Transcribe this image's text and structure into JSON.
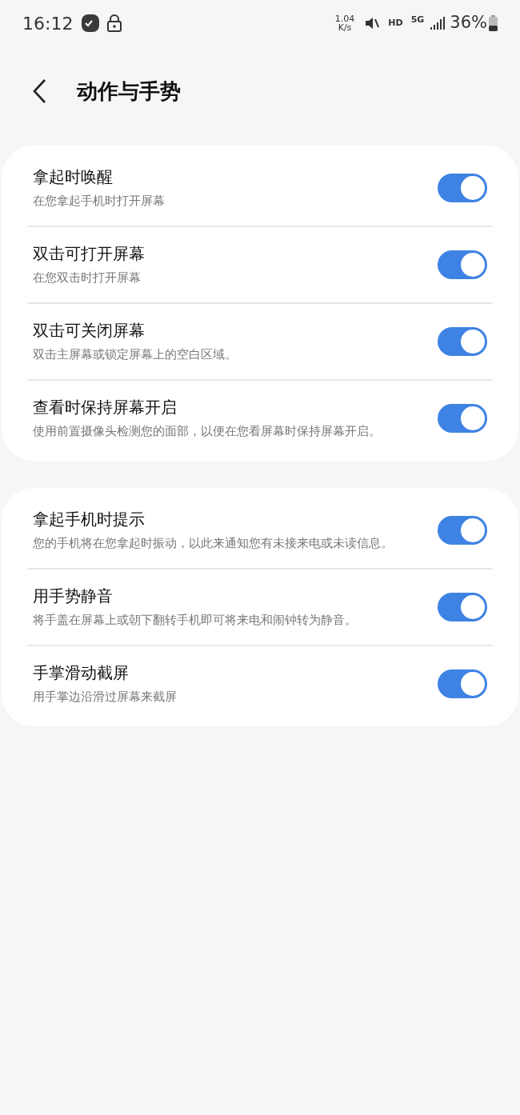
{
  "status_bar": {
    "time": "16:12",
    "net_speed": "1.04",
    "net_unit": "K/s",
    "hd": "HD",
    "network": "5G",
    "battery": "36%"
  },
  "header": {
    "title": "动作与手势"
  },
  "groups": [
    {
      "items": [
        {
          "title": "拿起时唤醒",
          "subtitle": "在您拿起手机时打开屏幕",
          "on": true
        },
        {
          "title": "双击可打开屏幕",
          "subtitle": "在您双击时打开屏幕",
          "on": true
        },
        {
          "title": "双击可关闭屏幕",
          "subtitle": "双击主屏幕或锁定屏幕上的空白区域。",
          "on": true
        },
        {
          "title": "查看时保持屏幕开启",
          "subtitle": "使用前置摄像头检测您的面部，以便在您看屏幕时保持屏幕开启。",
          "on": true
        }
      ]
    },
    {
      "items": [
        {
          "title": "拿起手机时提示",
          "subtitle": "您的手机将在您拿起时振动，以此来通知您有未接来电或未读信息。",
          "on": true
        },
        {
          "title": "用手势静音",
          "subtitle": "将手盖在屏幕上或朝下翻转手机即可将来电和闹钟转为静音。",
          "on": true
        },
        {
          "title": "手掌滑动截屏",
          "subtitle": "用手掌边沿滑过屏幕来截屏",
          "on": true
        }
      ]
    }
  ]
}
